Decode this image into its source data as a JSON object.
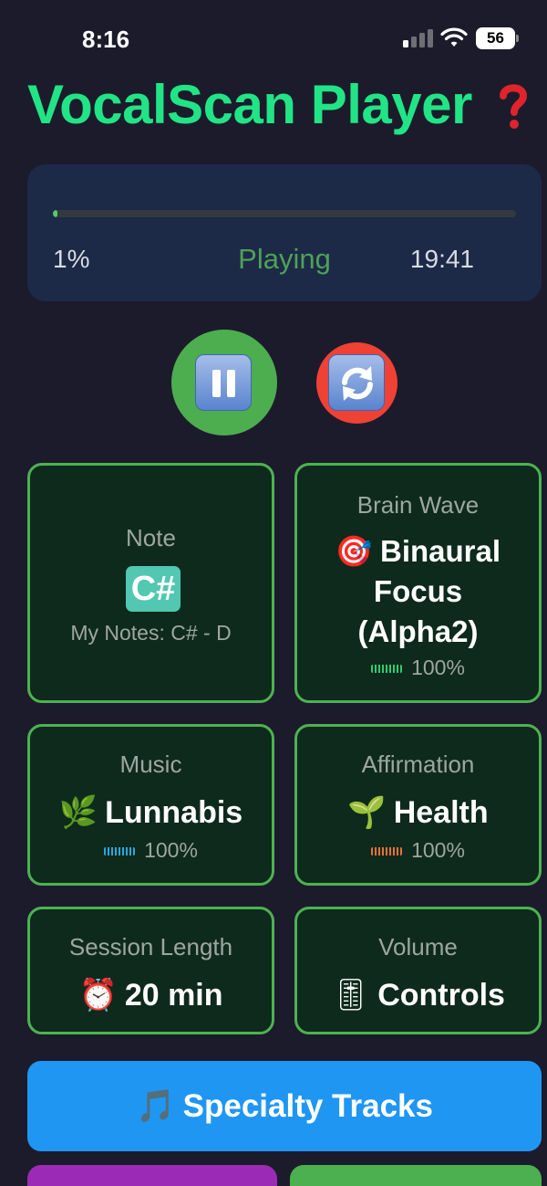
{
  "status_bar": {
    "time": "8:16",
    "battery": "56",
    "icons": [
      "cellular-signal-icon",
      "wifi-icon",
      "battery-icon"
    ]
  },
  "header": {
    "title": "VocalScan Player",
    "help_icon": "question-mark-icon"
  },
  "progress": {
    "percent_label": "1%",
    "fraction": 0.01,
    "status": "Playing",
    "time": "19:41"
  },
  "controls": {
    "pause_icon": "pause-icon",
    "restart_icon": "repeat-icon"
  },
  "cards": {
    "note": {
      "label": "Note",
      "value": "C#",
      "sub": "My Notes: C# - D"
    },
    "brain_wave": {
      "label": "Brain Wave",
      "icon": "dart-target-icon",
      "icon_char": "🎯",
      "value_line1": "Binaural",
      "value_line2": "Focus",
      "value_line3": "(Alpha2)",
      "level": "100%",
      "meter_color": "#2ecc71"
    },
    "music": {
      "label": "Music",
      "icon": "herb-icon",
      "icon_char": "🌿",
      "value": "Lunnabis",
      "level": "100%",
      "meter_color": "#29a8e0"
    },
    "affirmation": {
      "label": "Affirmation",
      "icon": "seedling-icon",
      "icon_char": "🌱",
      "value": "Health",
      "level": "100%",
      "meter_color": "#e8703a"
    },
    "session": {
      "label": "Session Length",
      "icon": "alarm-clock-icon",
      "icon_char": "⏰",
      "value": "20 min"
    },
    "volume": {
      "label": "Volume",
      "icon": "level-slider-icon",
      "icon_char": "🎚",
      "value": "Controls"
    }
  },
  "buttons": {
    "specialty": {
      "icon": "musical-note-icon",
      "icon_char": "🎵",
      "label": "Specialty Tracks"
    }
  },
  "colors": {
    "background": "#1c1b2b",
    "title": "#21e486",
    "card_border": "#4db251",
    "card_bg": "#0e2a1c",
    "progress_card": "#1c2a48",
    "playing": "#4ea157",
    "pause_button": "#4cae4f",
    "restart_button": "#f04135",
    "specialty_button": "#2096f3",
    "purple_button": "#9b2bb6",
    "green_button": "#4caf50"
  }
}
